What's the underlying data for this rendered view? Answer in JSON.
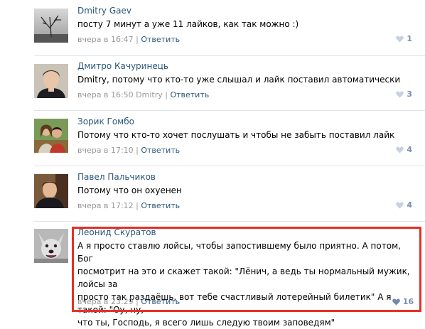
{
  "comments": [
    {
      "author": "Dmitry Gaev",
      "text": "посту 7 минут а уже 11 лайков, как так можно :)",
      "date": "вчера в 16:47",
      "reply_to": "",
      "reply_label": "Ответить",
      "likes": "1"
    },
    {
      "author": "Дмитро Качуринець",
      "text": "Dmitry, потому что кто-то уже слышал и лайк поставил автоматически",
      "date": "вчера в 16:50",
      "reply_to": "Dmitry",
      "reply_label": "Ответить",
      "likes": "3"
    },
    {
      "author": "Зорик Гомбо",
      "text": "Потому что кто-то хочет послушать и чтобы не забыть поставил лайк",
      "date": "вчера в 17:10",
      "reply_to": "",
      "reply_label": "Ответить",
      "likes": "4"
    },
    {
      "author": "Павел Пальчиков",
      "text": "Потому что он охуенен",
      "date": "вчера в 17:12",
      "reply_to": "",
      "reply_label": "Ответить",
      "likes": "4"
    },
    {
      "author": "Леонид Скуратов",
      "text_lines": [
        "А я просто ставлю лойсы, чтобы запостившему было приятно. А потом, Бог",
        "посмотрит на это и скажет такой: \"Лёнич, а ведь ты нормальный мужик, лойсы за",
        "просто так раздаёшь, вот тебе счастливый лотерейный билетик\" А я такой: \"Оу, ну,",
        "что ты, Господь, я всего лишь следую твоим заповедям\""
      ],
      "date": "вчера в 23:29",
      "reply_label": "Ответить",
      "likes": "16"
    }
  ],
  "colors": {
    "link": "#2b587a",
    "meta": "#999999",
    "likes": "#7a8fa7",
    "highlight": "#e53026",
    "separator": "#dfe4ea"
  },
  "icons": [
    "heart-icon"
  ]
}
